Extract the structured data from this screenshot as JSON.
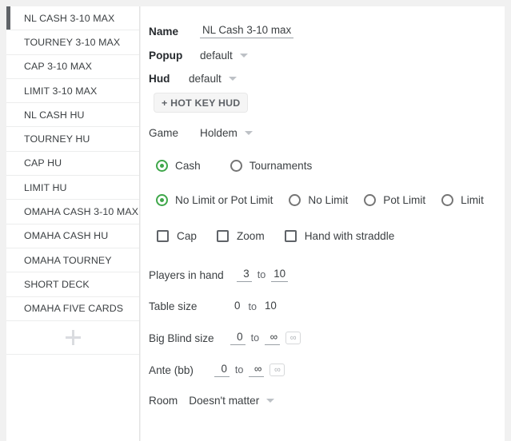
{
  "sidebar": {
    "items": [
      {
        "label": "NL CASH 3-10 MAX",
        "active": true
      },
      {
        "label": "TOURNEY 3-10 MAX",
        "active": false
      },
      {
        "label": "CAP 3-10 MAX",
        "active": false
      },
      {
        "label": "LIMIT 3-10 MAX",
        "active": false
      },
      {
        "label": "NL CASH HU",
        "active": false
      },
      {
        "label": "TOURNEY HU",
        "active": false
      },
      {
        "label": "CAP HU",
        "active": false
      },
      {
        "label": "LIMIT HU",
        "active": false
      },
      {
        "label": "OMAHA CASH 3-10 MAX",
        "active": false
      },
      {
        "label": "OMAHA CASH HU",
        "active": false
      },
      {
        "label": "OMAHA TOURNEY",
        "active": false
      },
      {
        "label": "SHORT DECK",
        "active": false
      },
      {
        "label": "OMAHA FIVE CARDS",
        "active": false
      }
    ],
    "add_icon": "plus-icon"
  },
  "form": {
    "name_label": "Name",
    "name_value": "NL Cash 3-10 max",
    "popup_label": "Popup",
    "popup_value": "default",
    "hud_label": "Hud",
    "hud_value": "default",
    "hotkey_button": "+ HOT KEY HUD",
    "game_label": "Game",
    "game_value": "Holdem",
    "cash_tourney": [
      {
        "label": "Cash",
        "selected": true
      },
      {
        "label": "Tournaments",
        "selected": false
      }
    ],
    "limit_type": [
      {
        "label": "No Limit or Pot Limit",
        "selected": true
      },
      {
        "label": "No Limit",
        "selected": false
      },
      {
        "label": "Pot Limit",
        "selected": false
      },
      {
        "label": "Limit",
        "selected": false
      }
    ],
    "checkboxes": [
      {
        "label": "Cap",
        "checked": false
      },
      {
        "label": "Zoom",
        "checked": false
      },
      {
        "label": "Hand with straddle",
        "checked": false
      }
    ],
    "ranges": [
      {
        "label": "Players in hand",
        "min": "3",
        "to": "to",
        "max": "10",
        "underlined": true,
        "infinity": false
      },
      {
        "label": "Table size",
        "min": "0",
        "to": "to",
        "max": "10",
        "underlined": false,
        "infinity": false
      },
      {
        "label": "Big Blind size",
        "min": "0",
        "to": "to",
        "max": "∞",
        "underlined": true,
        "infinity": true,
        "infinity_icon": "∞"
      },
      {
        "label": "Ante (bb)",
        "min": "0",
        "to": "to",
        "max": "∞",
        "underlined": true,
        "infinity": true,
        "infinity_icon": "∞"
      }
    ],
    "room_label": "Room",
    "room_value": "Doesn't matter"
  },
  "colors": {
    "accent_green": "#3fa74a",
    "active_bar": "#5f6368",
    "page_bg": "#f1f1f1",
    "panel_bg": "#ffffff"
  }
}
